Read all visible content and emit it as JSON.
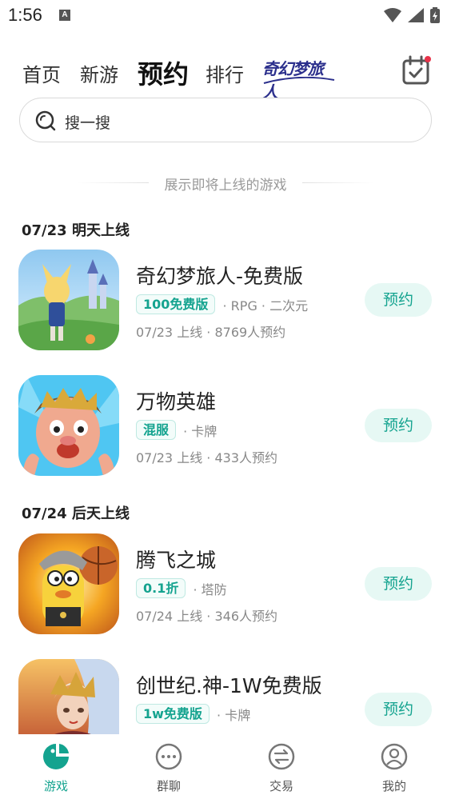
{
  "status_bar": {
    "time": "1:56",
    "notification_letter": "A"
  },
  "top_nav": {
    "tabs": [
      {
        "label": "首页",
        "active": false
      },
      {
        "label": "新游",
        "active": false
      },
      {
        "label": "预约",
        "active": true
      },
      {
        "label": "排行",
        "active": false
      }
    ],
    "logo_text": "奇幻梦旅人",
    "calendar_icon": "calendar-check-icon"
  },
  "search": {
    "placeholder": "搜一搜"
  },
  "divider_note": "展示即将上线的游戏",
  "sections": [
    {
      "header": "07/23 明天上线",
      "games": [
        {
          "title": "奇幻梦旅人-免费版",
          "badge": "100免费版",
          "tags": "· RPG · 二次元",
          "sub": "07/23 上线 · 8769人预约",
          "button": "预约"
        },
        {
          "title": "万物英雄",
          "badge": "混服",
          "tags": "· 卡牌",
          "sub": "07/23 上线 · 433人预约",
          "button": "预约"
        }
      ]
    },
    {
      "header": "07/24 后天上线",
      "games": [
        {
          "title": "腾飞之城",
          "badge": "0.1折",
          "tags": "· 塔防",
          "sub": "07/24 上线 · 346人预约",
          "button": "预约"
        },
        {
          "title": "创世纪.神-1W免费版",
          "badge": "1w免费版",
          "tags": "· 卡牌",
          "sub": "",
          "button": "预约"
        }
      ]
    }
  ],
  "bottom_nav": [
    {
      "label": "游戏",
      "icon": "game-icon",
      "active": true
    },
    {
      "label": "群聊",
      "icon": "chat-icon",
      "active": false
    },
    {
      "label": "交易",
      "icon": "exchange-icon",
      "active": false
    },
    {
      "label": "我的",
      "icon": "profile-icon",
      "active": false
    }
  ],
  "colors": {
    "accent": "#14a38f",
    "button_bg": "#e6f8f4",
    "muted_text": "#888888"
  }
}
